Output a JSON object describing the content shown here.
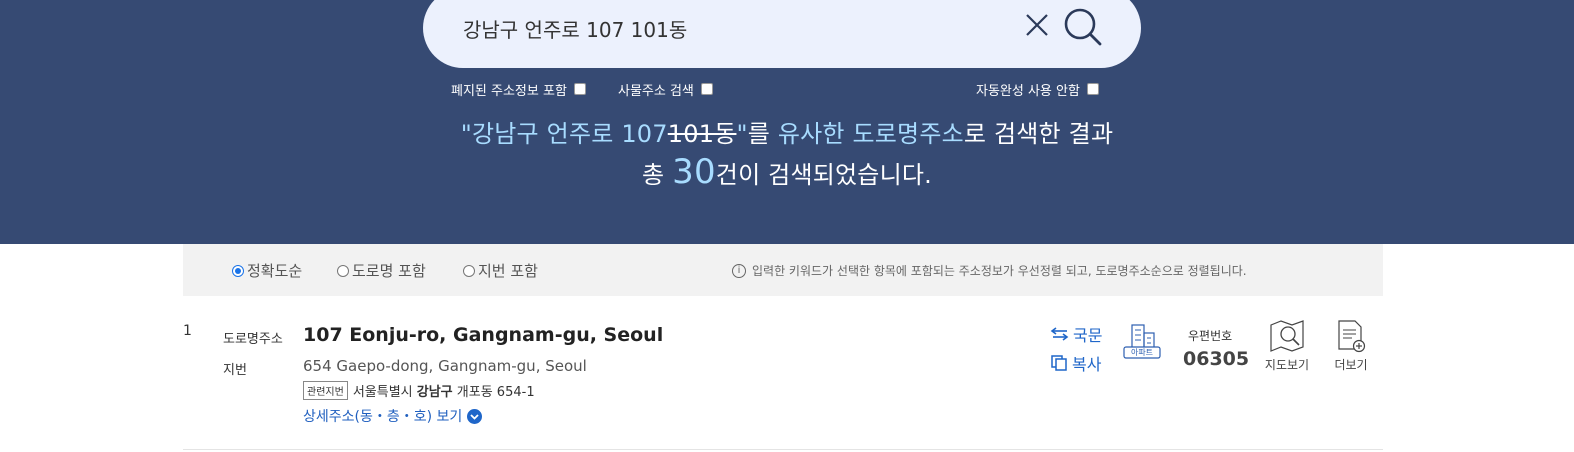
{
  "search": {
    "value": "강남구 언주로 107 101동",
    "placeholder": ""
  },
  "options": {
    "include_abolished": "폐지된 주소정보 포함",
    "things_search": "사물주소 검색",
    "no_autocomplete": "자동완성 사용 안함"
  },
  "result_message": {
    "open_quote": "\"",
    "keyword_main": "강남구 언주로 107",
    "keyword_struck": "101동",
    "close_quote": "\"",
    "particle": "를 ",
    "similar": "유사한 도로명주소",
    "rest": "로 검색한 결과",
    "total_prefix": "총 ",
    "count": "30",
    "total_suffix": "건이 검색되었습니다."
  },
  "sort": {
    "options": [
      "정확도순",
      "도로명 포함",
      "지번 포함"
    ],
    "selected": "정확도순",
    "info": "입력한 키워드가 선택한 항목에 포함되는 주소정보가 우선정렬 되고, 도로명주소순으로 정렬됩니다."
  },
  "results": [
    {
      "index": "1",
      "road_label": "도로명주소",
      "road_address": "107 Eonju-ro, Gangnam-gu, Seoul",
      "jibun_label": "지번",
      "jibun_address": "654 Gaepo-dong, Gangnam-gu, Seoul",
      "related_tag": "관련지번",
      "related_city": "서울특별시",
      "related_gu": "강남구",
      "related_rest": "개포동 654-1",
      "detail_link": "상세주소(동・층・호) 보기",
      "korean_link": "국문",
      "copy_link": "복사",
      "building_badge": "아파트",
      "zip_label": "우편번호",
      "zip_code": "06305",
      "map_label": "지도보기",
      "more_label": "더보기"
    }
  ],
  "colors": {
    "hero_bg": "#364a73",
    "highlight": "#a8dcff",
    "link": "#1f66c9",
    "search_bg": "#ecf1fd"
  }
}
